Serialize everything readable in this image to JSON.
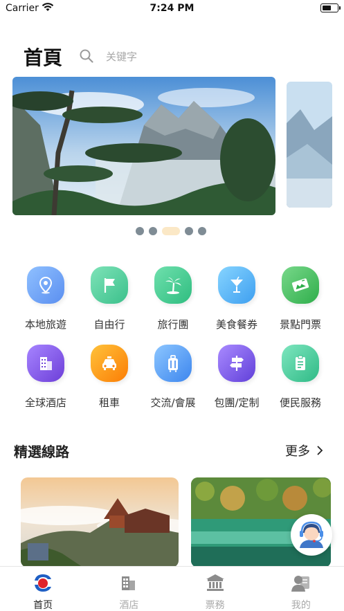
{
  "status_bar": {
    "carrier": "Carrier",
    "time": "7:24 PM",
    "battery_level": 0.6
  },
  "header": {
    "title": "首頁",
    "search_placeholder": "关键字"
  },
  "banner": {
    "slide_count": 5,
    "active_index": 2
  },
  "grid": [
    {
      "label": "本地旅遊",
      "icon": "location-pin-icon",
      "color": "#6aa4f5"
    },
    {
      "label": "自由行",
      "icon": "flag-icon",
      "color": "#4fcf9c"
    },
    {
      "label": "旅行團",
      "icon": "palm-tree-icon",
      "color": "#45cf95"
    },
    {
      "label": "美食餐券",
      "icon": "cocktail-icon",
      "color": "#58b8f2"
    },
    {
      "label": "景點門票",
      "icon": "ticket-icon",
      "color": "#48c063"
    },
    {
      "label": "全球酒店",
      "icon": "hotel-building-icon",
      "color": "#8a5ce6"
    },
    {
      "label": "租車",
      "icon": "taxi-icon",
      "color": "#fb8f12"
    },
    {
      "label": "交流/會展",
      "icon": "luggage-icon",
      "color": "#5a9ef5"
    },
    {
      "label": "包團/定制",
      "icon": "signpost-icon",
      "color": "#7d5de6"
    },
    {
      "label": "便民服務",
      "icon": "clipboard-icon",
      "color": "#4bc79a"
    }
  ],
  "section": {
    "title": "精選線路",
    "more": "更多"
  },
  "tabs": [
    {
      "label": "首页",
      "icon": "home-logo-icon",
      "active": true
    },
    {
      "label": "酒店",
      "icon": "hotel-icon",
      "active": false
    },
    {
      "label": "票務",
      "icon": "ticket-building-icon",
      "active": false
    },
    {
      "label": "我的",
      "icon": "user-profile-icon",
      "active": false
    }
  ]
}
